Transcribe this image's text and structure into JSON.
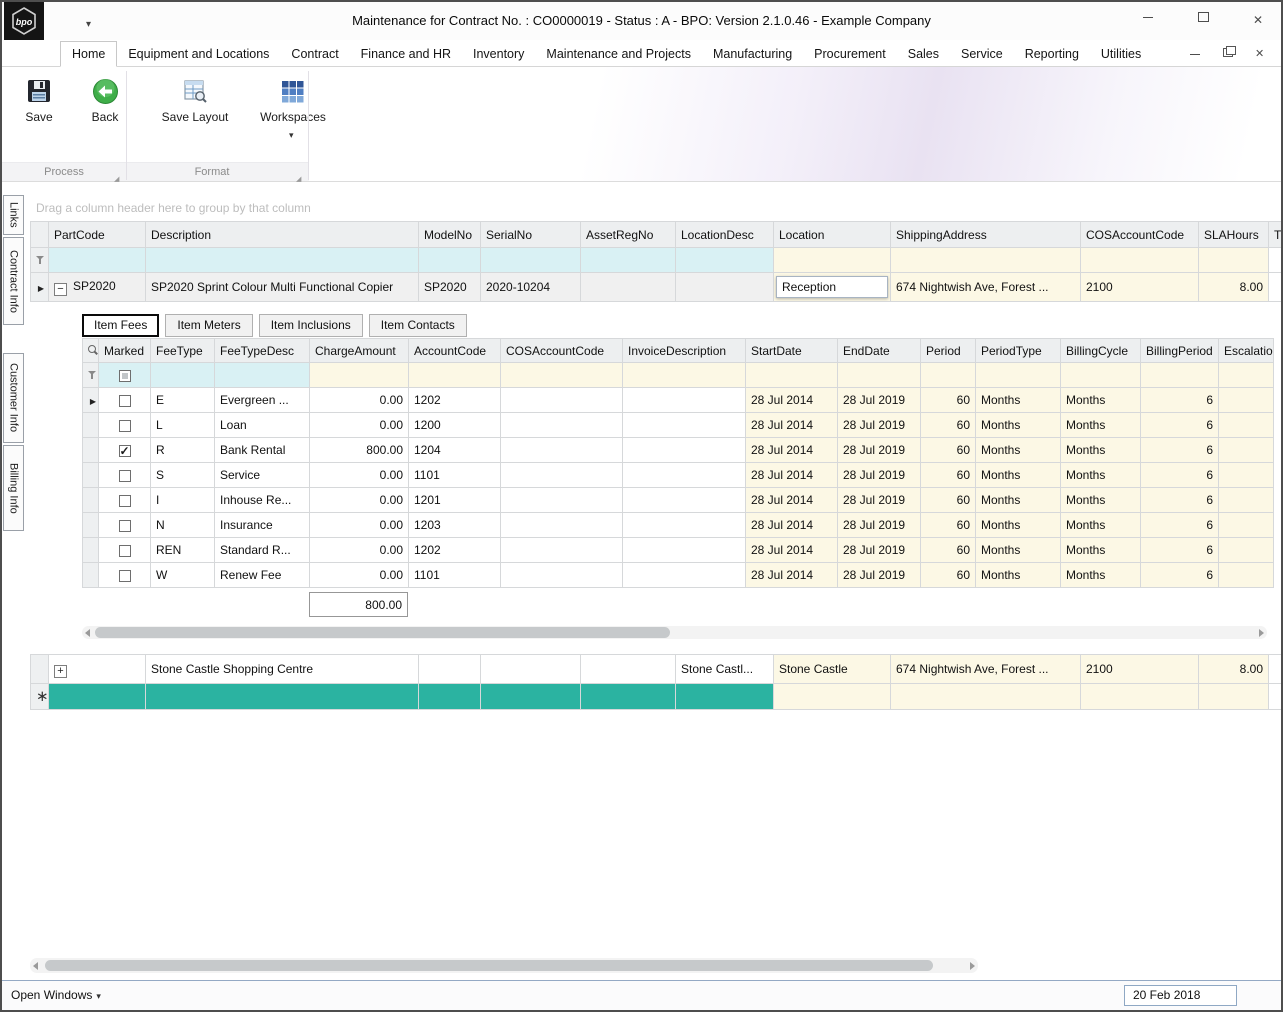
{
  "window": {
    "title": "Maintenance for Contract No. : CO0000019 - Status : A - BPO: Version 2.1.0.46 - Example Company",
    "logo_text": "bpo"
  },
  "ribbon": {
    "tabs": [
      {
        "label": "Home",
        "active": true
      },
      {
        "label": "Equipment and Locations"
      },
      {
        "label": "Contract"
      },
      {
        "label": "Finance and HR"
      },
      {
        "label": "Inventory"
      },
      {
        "label": "Maintenance and Projects"
      },
      {
        "label": "Manufacturing"
      },
      {
        "label": "Procurement"
      },
      {
        "label": "Sales"
      },
      {
        "label": "Service"
      },
      {
        "label": "Reporting"
      },
      {
        "label": "Utilities"
      }
    ],
    "buttons": {
      "save": "Save",
      "back": "Back",
      "save_layout": "Save Layout",
      "workspaces": "Workspaces"
    },
    "groups": {
      "process": "Process",
      "format": "Format"
    }
  },
  "side_tabs": [
    "Links",
    "Contract Info",
    "Customer Info",
    "Billing Info"
  ],
  "grid": {
    "groupby_hint": "Drag a column header here to group by that column",
    "columns": {
      "partcode": "PartCode",
      "description": "Description",
      "modelno": "ModelNo",
      "serialno": "SerialNo",
      "assetregno": "AssetRegNo",
      "locationdesc": "LocationDesc",
      "location": "Location",
      "shipping": "ShippingAddress",
      "cos": "COSAccountCode",
      "sla": "SLAHours",
      "overflow": "T"
    },
    "rows": [
      {
        "partcode": "SP2020",
        "description": "SP2020 Sprint Colour Multi Functional Copier",
        "modelno": "SP2020",
        "serialno": "2020-10204",
        "location": "Reception",
        "shipping": "674 Nightwish Ave, Forest ...",
        "cos": "2100",
        "sla": "8.00"
      },
      {
        "description": "Stone Castle Shopping Centre",
        "locationdesc": "Stone Castl...",
        "location": "Stone Castle",
        "shipping": "674 Nightwish Ave, Forest ...",
        "cos": "2100",
        "sla": "8.00"
      }
    ]
  },
  "detail": {
    "tabs": [
      {
        "label": "Item Fees",
        "active": true
      },
      {
        "label": "Item Meters"
      },
      {
        "label": "Item Inclusions"
      },
      {
        "label": "Item Contacts"
      }
    ],
    "columns": {
      "marked": "Marked",
      "feetype": "FeeType",
      "feetypedesc": "FeeTypeDesc",
      "charge": "ChargeAmount",
      "account": "AccountCode",
      "cos": "COSAccountCode",
      "invoice": "InvoiceDescription",
      "start": "StartDate",
      "end": "EndDate",
      "period": "Period",
      "periodtype": "PeriodType",
      "billingcycle": "BillingCycle",
      "billingperiod": "BillingPeriod",
      "escalation": "Escalatio"
    },
    "rows": [
      {
        "current": true,
        "marked": false,
        "feetype": "E",
        "feetypedesc": "Evergreen ...",
        "charge": "0.00",
        "account": "1202",
        "start": "28 Jul 2014",
        "end": "28 Jul 2019",
        "period": "60",
        "periodtype": "Months",
        "billingcycle": "Months",
        "billingperiod": "6"
      },
      {
        "marked": false,
        "feetype": "L",
        "feetypedesc": "Loan",
        "charge": "0.00",
        "account": "1200",
        "start": "28 Jul 2014",
        "end": "28 Jul 2019",
        "period": "60",
        "periodtype": "Months",
        "billingcycle": "Months",
        "billingperiod": "6"
      },
      {
        "marked": true,
        "feetype": "R",
        "feetypedesc": "Bank Rental",
        "charge": "800.00",
        "account": "1204",
        "start": "28 Jul 2014",
        "end": "28 Jul 2019",
        "period": "60",
        "periodtype": "Months",
        "billingcycle": "Months",
        "billingperiod": "6"
      },
      {
        "marked": false,
        "feetype": "S",
        "feetypedesc": "Service",
        "charge": "0.00",
        "account": "1101",
        "start": "28 Jul 2014",
        "end": "28 Jul 2019",
        "period": "60",
        "periodtype": "Months",
        "billingcycle": "Months",
        "billingperiod": "6"
      },
      {
        "marked": false,
        "feetype": "I",
        "feetypedesc": "Inhouse Re...",
        "charge": "0.00",
        "account": "1201",
        "start": "28 Jul 2014",
        "end": "28 Jul 2019",
        "period": "60",
        "periodtype": "Months",
        "billingcycle": "Months",
        "billingperiod": "6"
      },
      {
        "marked": false,
        "feetype": "N",
        "feetypedesc": "Insurance",
        "charge": "0.00",
        "account": "1203",
        "start": "28 Jul 2014",
        "end": "28 Jul 2019",
        "period": "60",
        "periodtype": "Months",
        "billingcycle": "Months",
        "billingperiod": "6"
      },
      {
        "marked": false,
        "feetype": "REN",
        "feetypedesc": "Standard R...",
        "charge": "0.00",
        "account": "1202",
        "start": "28 Jul 2014",
        "end": "28 Jul 2019",
        "period": "60",
        "periodtype": "Months",
        "billingcycle": "Months",
        "billingperiod": "6"
      },
      {
        "marked": false,
        "feetype": "W",
        "feetypedesc": "Renew Fee",
        "charge": "0.00",
        "account": "1101",
        "start": "28 Jul 2014",
        "end": "28 Jul 2019",
        "period": "60",
        "periodtype": "Months",
        "billingcycle": "Months",
        "billingperiod": "6"
      }
    ],
    "summary_total": "800.00"
  },
  "statusbar": {
    "open_windows": "Open Windows",
    "date": "20 Feb 2018"
  },
  "colors": {
    "accent_teal": "#2bb3a1",
    "filter_blue": "#d9f1f4",
    "cell_yellow": "#fcf8e5"
  }
}
